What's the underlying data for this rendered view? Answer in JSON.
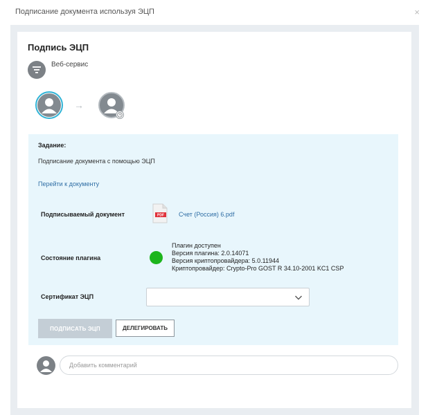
{
  "modal": {
    "title": "Подписание документа используя ЭЦП",
    "close_glyph": "×"
  },
  "card": {
    "title": "Подпись ЭЦП",
    "service_label": "Веб-сервис",
    "step_arrow": "→"
  },
  "task": {
    "label": "Задание:",
    "text": "Подписание документа с помощью ЭЦП",
    "link": "Перейти к документу"
  },
  "document": {
    "label": "Подписываемый документ",
    "file_name": "Счет (Россия) 6.pdf",
    "file_badge": "PDF"
  },
  "plugin": {
    "label": "Состояние плагина",
    "status_color": "#1cb51c",
    "lines": [
      "Плагин доступен",
      "Версия плагина: 2.0.14071",
      "Версия криптопровайдера: 5.0.11944",
      "Криптопровайдер: Crypto-Pro GOST R 34.10-2001 KC1 CSP"
    ]
  },
  "certificate": {
    "label": "Сертификат ЭЦП",
    "selected": ""
  },
  "buttons": {
    "sign": "ПОДПИСАТЬ ЭЦП",
    "delegate": "ДЕЛЕГИРОВАТЬ"
  },
  "comment": {
    "placeholder": "Добавить комментарий",
    "value": ""
  },
  "colors": {
    "accent_ring": "#2fb3d6",
    "link": "#2e6da4",
    "panel_bg": "#e8f6fc",
    "sign_button_disabled": "#c4ced6"
  }
}
